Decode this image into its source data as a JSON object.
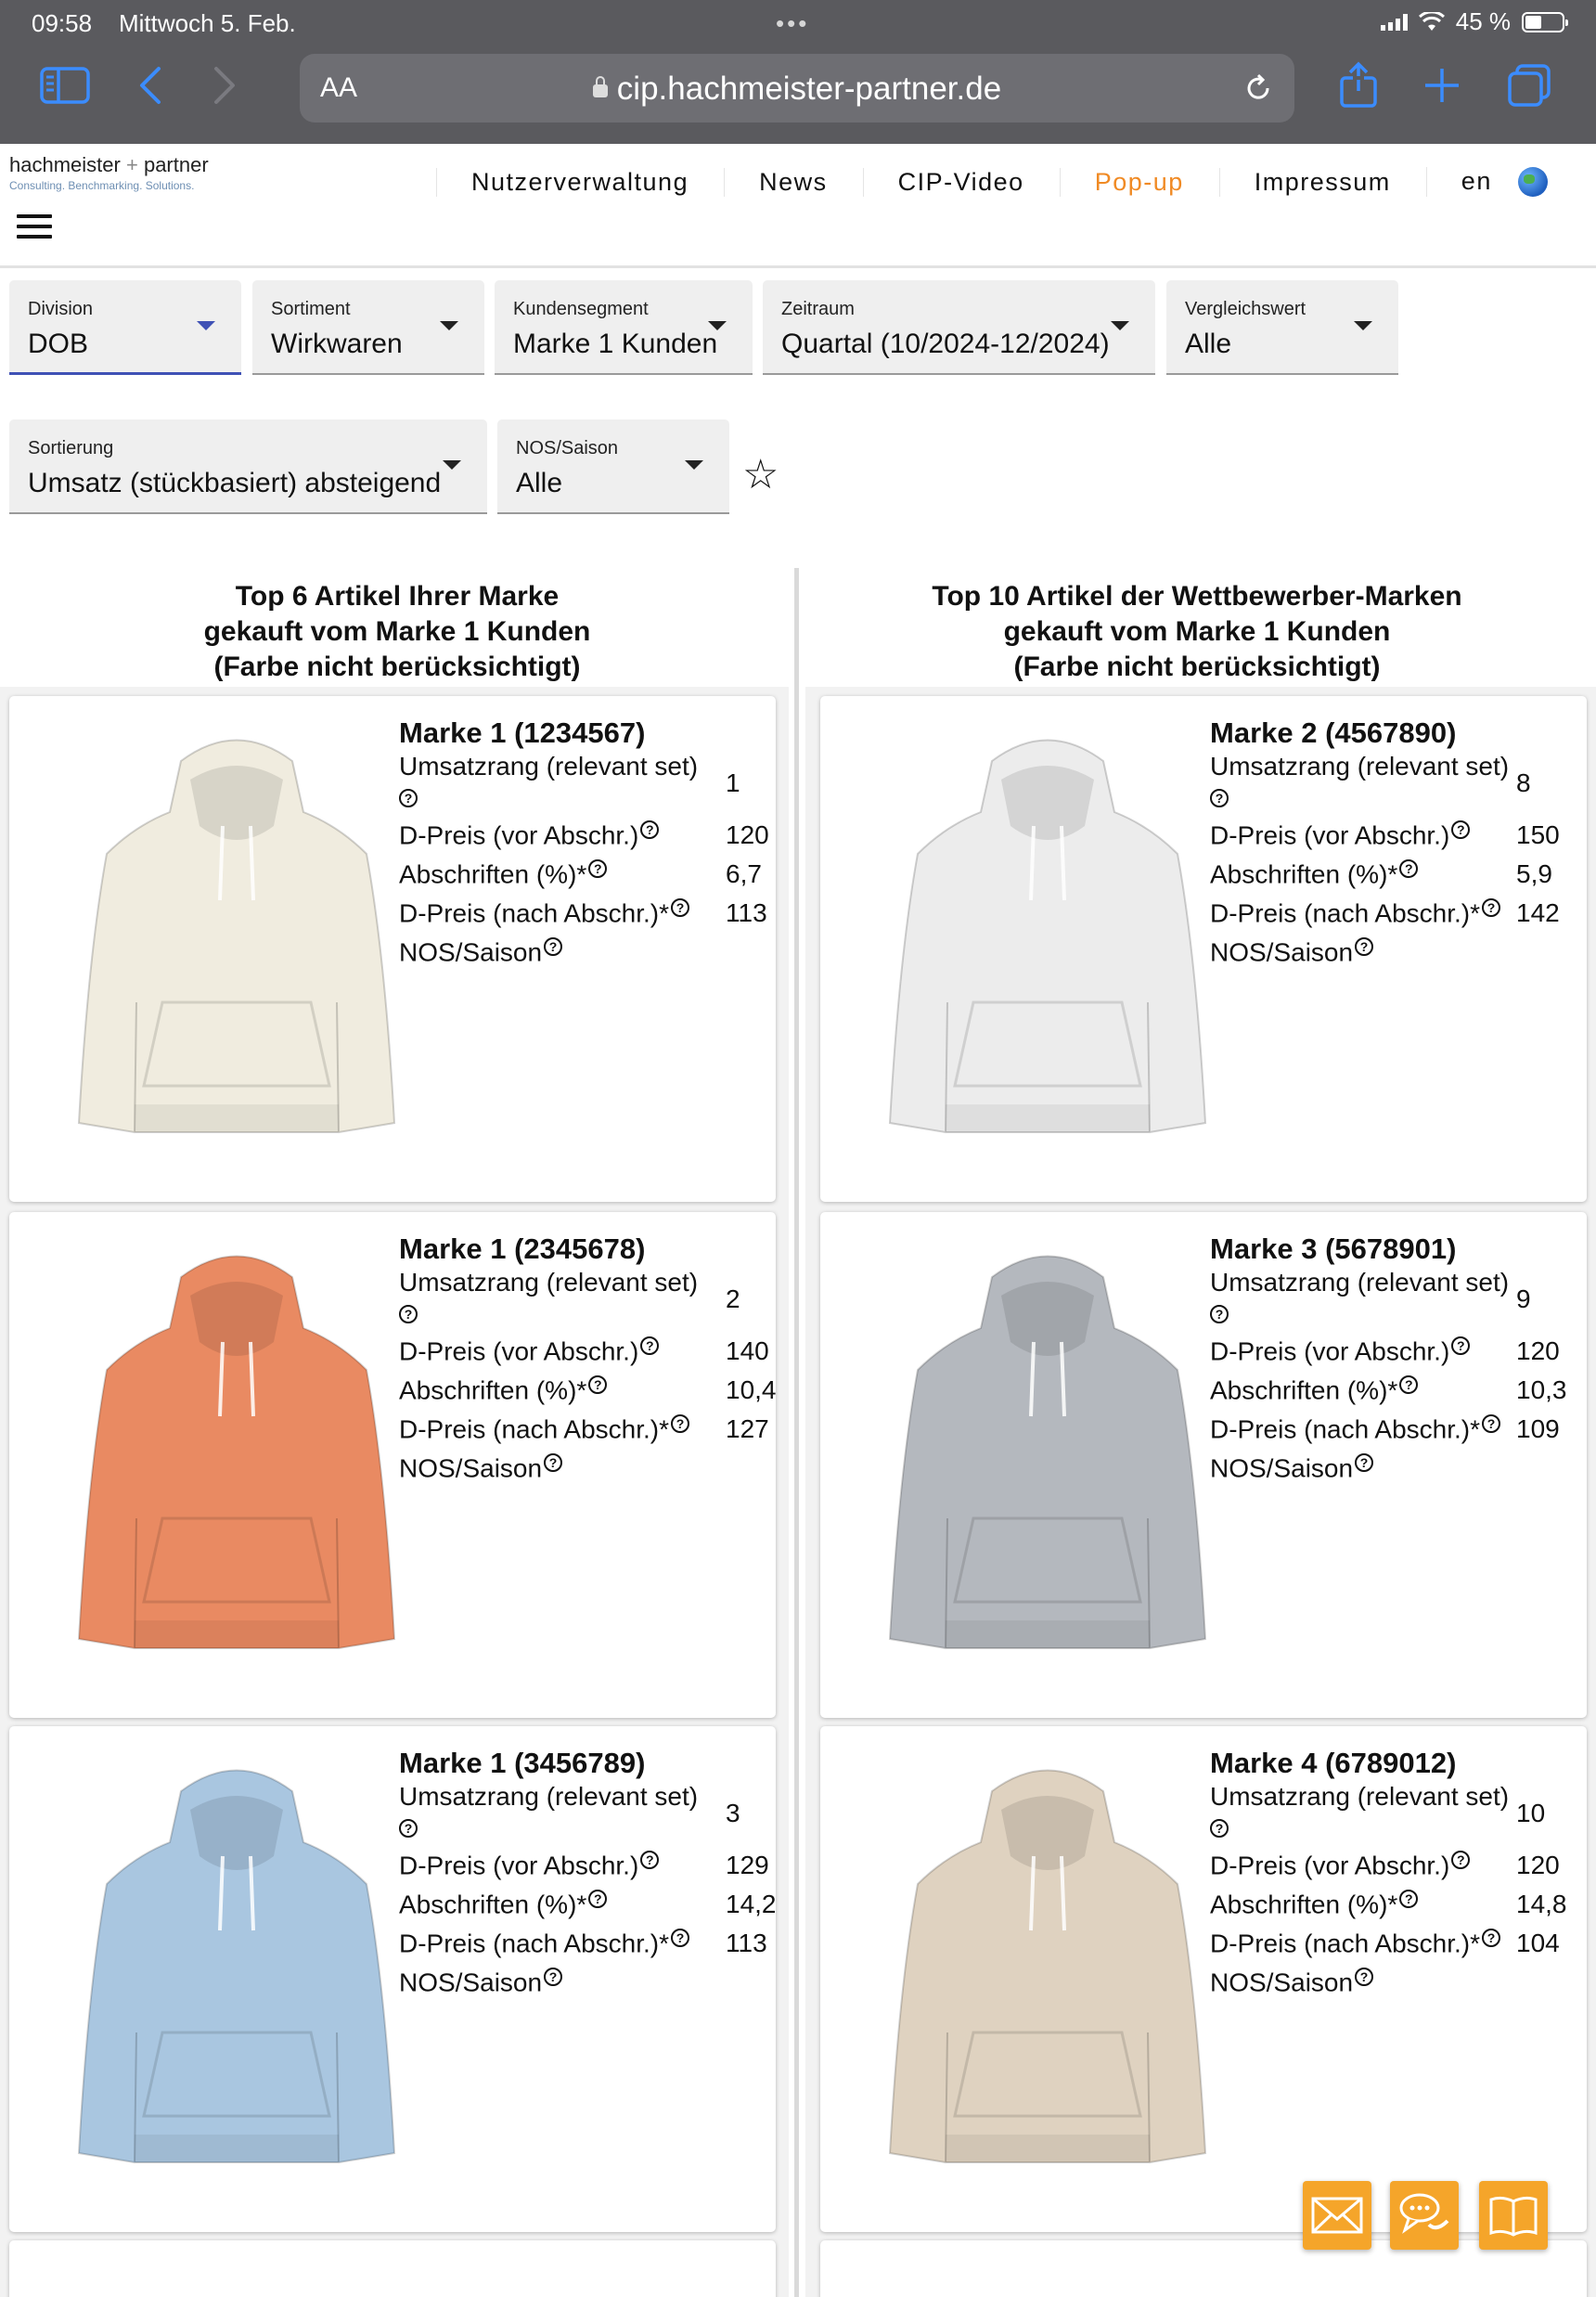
{
  "status": {
    "time": "09:58",
    "date": "Mittwoch 5. Feb.",
    "dots": "•••",
    "battery": "45 %",
    "battery_level": 0.45
  },
  "browser": {
    "aa": "AA",
    "url": "cip.hachmeister-partner.de"
  },
  "logo": {
    "name": "hachmeister",
    "plus": "+",
    "partner": "partner",
    "tagline": "Consulting. Benchmarking. Solutions."
  },
  "nav": [
    "Nutzerverwaltung",
    "News",
    "CIP-Video",
    "Pop-up",
    "Impressum",
    "en"
  ],
  "nav_active": "Pop-up",
  "filters": [
    {
      "label": "Division",
      "value": "DOB"
    },
    {
      "label": "Sortiment",
      "value": "Wirkwaren"
    },
    {
      "label": "Kundensegment",
      "value": "Marke 1 Kunden"
    },
    {
      "label": "Zeitraum",
      "value": "Quartal (10/2024-12/2024)"
    },
    {
      "label": "Vergleichswert",
      "value": "Alle"
    },
    {
      "label": "Sortierung",
      "value": "Umsatz (stückbasiert) absteigend"
    },
    {
      "label": "NOS/Saison",
      "value": "Alle"
    }
  ],
  "columns": {
    "left": {
      "line1": "Top 6 Artikel Ihrer Marke",
      "line2": "gekauft vom Marke 1 Kunden",
      "line3": "(Farbe nicht berücksichtigt)"
    },
    "right": {
      "line1": "Top 10 Artikel der Wettbewerber-Marken",
      "line2": "gekauft vom Marke 1 Kunden",
      "line3": "(Farbe nicht berücksichtigt)"
    }
  },
  "labels": {
    "rank": "Umsatzrang (relevant set)",
    "dprice_before": "D-Preis (vor Abschr.)",
    "markdown": "Abschriften (%)*",
    "dprice_after": "D-Preis (nach Abschr.)*",
    "nos": "NOS/Saison",
    "q": "?"
  },
  "cards_left": [
    {
      "title": "Marke 1 (1234567)",
      "rank": "1",
      "price_before": "120",
      "markdown": "6,7",
      "price_after": "113",
      "color": "#f0ecdf"
    },
    {
      "title": "Marke 1 (2345678)",
      "rank": "2",
      "price_before": "140",
      "markdown": "10,4",
      "price_after": "127",
      "color": "#e98a62"
    },
    {
      "title": "Marke 1 (3456789)",
      "rank": "3",
      "price_before": "129",
      "markdown": "14,2",
      "price_after": "113",
      "color": "#a9c6e0"
    }
  ],
  "cards_right": [
    {
      "title": "Marke 2 (4567890)",
      "rank": "8",
      "price_before": "150",
      "markdown": "5,9",
      "price_after": "142",
      "color": "#ececec"
    },
    {
      "title": "Marke 3 (5678901)",
      "rank": "9",
      "price_before": "120",
      "markdown": "10,3",
      "price_after": "109",
      "color": "#b4b8be"
    },
    {
      "title": "Marke 4 (6789012)",
      "rank": "10",
      "price_before": "120",
      "markdown": "14,8",
      "price_after": "104",
      "color": "#dfd2c0"
    }
  ],
  "fab_icons": [
    "mail-icon",
    "chat-icon",
    "book-icon"
  ],
  "accent": "#f08a24"
}
